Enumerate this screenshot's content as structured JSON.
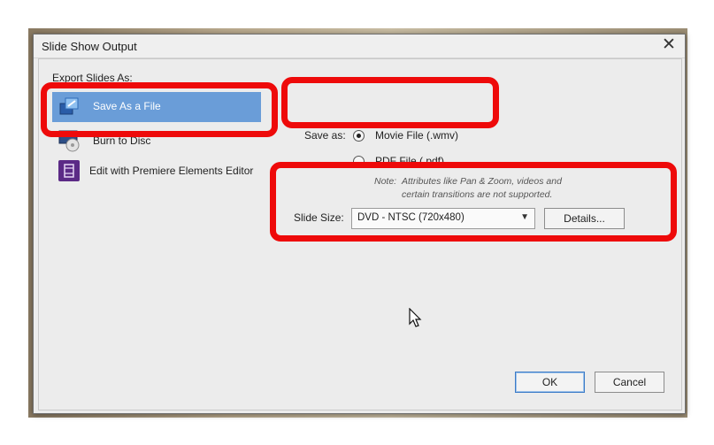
{
  "window": {
    "title": "Slide Show Output"
  },
  "export": {
    "section_label": "Export Slides As:",
    "items": [
      {
        "label": "Save As a File",
        "icon": "save-file-icon",
        "selected": true
      },
      {
        "label": "Burn to Disc",
        "icon": "burn-disc-icon",
        "selected": false
      },
      {
        "label": "Edit with Premiere Elements Editor",
        "icon": "premiere-elements-icon",
        "selected": false
      }
    ]
  },
  "save_as": {
    "label": "Save as:",
    "options": [
      {
        "label": "Movie File (.wmv)",
        "selected": true
      },
      {
        "label": "PDF File (.pdf)",
        "selected": false
      }
    ],
    "note": [
      "Note:",
      "Attributes like Pan & Zoom, videos and",
      "certain transitions are not supported."
    ]
  },
  "slide_size": {
    "label": "Slide Size:",
    "value": "DVD - NTSC (720x480)",
    "details_label": "Details..."
  },
  "buttons": {
    "ok": "OK",
    "cancel": "Cancel"
  },
  "colors": {
    "highlight": "#ee0a0a",
    "selection": "#6a9dd8"
  }
}
